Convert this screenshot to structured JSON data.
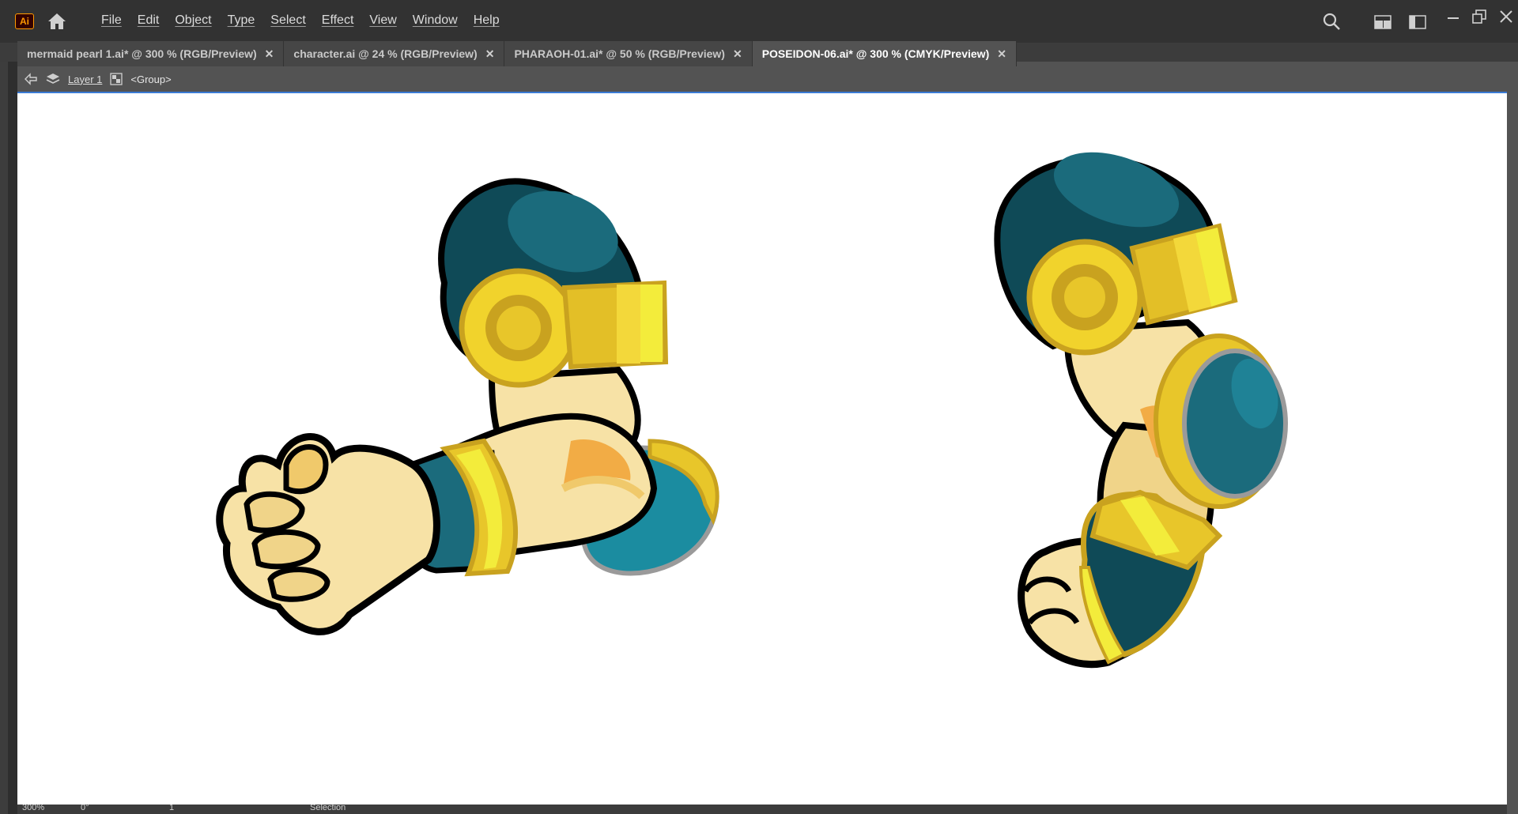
{
  "app": {
    "logo_text": "Ai",
    "accent": "#ff9a00"
  },
  "menu": {
    "items": [
      "File",
      "Edit",
      "Object",
      "Type",
      "Select",
      "Effect",
      "View",
      "Window",
      "Help"
    ]
  },
  "toolbar_icons": [
    "home-icon",
    "search-icon",
    "workspace-icon",
    "panel-icon",
    "minimize-icon",
    "restore-icon",
    "close-icon"
  ],
  "tabs": [
    {
      "label": "mermaid pearl 1.ai* @ 300 % (RGB/Preview)",
      "active": false
    },
    {
      "label": "character.ai @ 24 % (RGB/Preview)",
      "active": false
    },
    {
      "label": "PHARAOH-01.ai* @ 50 % (RGB/Preview)",
      "active": false
    },
    {
      "label": "POSEIDON-06.ai* @ 300 % (CMYK/Preview)",
      "active": true
    }
  ],
  "breadcrumb": {
    "layer": "Layer 1",
    "group": "<Group>"
  },
  "status": {
    "zoom": "300%",
    "rotation": "0°",
    "artboard": "1",
    "tool": "Selection"
  },
  "colors": {
    "teal_dark": "#0f4a57",
    "teal": "#1b6b7c",
    "gold": "#e8c62a",
    "gold_dark": "#c9a21f",
    "yellow_light": "#f3ec3b",
    "skin": "#f7e2a6",
    "skin_shade": "#f0c96b",
    "orange": "#f2ac45",
    "outline": "#000000"
  }
}
